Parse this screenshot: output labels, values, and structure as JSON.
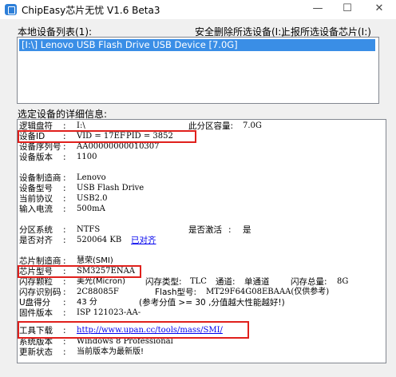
{
  "window": {
    "title": "ChipEasy芯片无忧 V1.6 Beta3",
    "min_glyph": "—",
    "max_glyph": "☐",
    "close_glyph": "✕"
  },
  "toolbar": {
    "device_list_label": "本地设备列表(1):",
    "safe_remove_link": "安全删除所选设备(I:)",
    "report_chip_link": "上报所选设备芯片(I:)"
  },
  "device_list": {
    "items": [
      "[I:\\] Lenovo USB Flash Drive USB Device [7.0G]"
    ]
  },
  "details": {
    "section_label": "选定设备的详细信息:",
    "logical_drive": {
      "label": "逻辑盘符",
      "value": "I:\\"
    },
    "partition_capacity": {
      "label": "此分区容量:",
      "value": "7.0G"
    },
    "device_id": {
      "label": "设备ID",
      "vid": "VID = 17EF",
      "pid": "PID = 3852"
    },
    "serial": {
      "label": "设备序列号",
      "value": "AA00000000010307"
    },
    "version": {
      "label": "设备版本",
      "value": "1100"
    },
    "vendor": {
      "label": "设备制造商",
      "value": "Lenovo"
    },
    "model": {
      "label": "设备型号",
      "value": "USB Flash Drive"
    },
    "protocol": {
      "label": "当前协议",
      "value": "USB2.0"
    },
    "current": {
      "label": "输入电流",
      "value": "500mA"
    },
    "filesystem": {
      "label": "分区系统",
      "value": "NTFS"
    },
    "active": {
      "label": "是否激活",
      "value": "是"
    },
    "aligned": {
      "label": "是否对齐",
      "value": "520064 KB",
      "link": "已对齐"
    },
    "chip_vendor": {
      "label": "芯片制造商",
      "value": "慧荣(SMI)"
    },
    "chip_model": {
      "label": "芯片型号",
      "value": "SM3257ENAA"
    },
    "flash_particle": {
      "label": "闪存颗粒",
      "value": "美光(Micron)",
      "type_label": "闪存类型:",
      "type_value": "TLC",
      "channel_label": "通道:",
      "channel_value": "单通道",
      "total_label": "闪存总量:",
      "total_value": "8G"
    },
    "flash_id": {
      "label": "闪存识别码",
      "value": "2C88085F",
      "flash_model_label": "Flash型号:",
      "flash_model_value": "MT29F64G08EBAAA(仅供参考)"
    },
    "udisk_score": {
      "label": "U盘得分",
      "value": "43 分",
      "note": "(参考分值 >= 30 ,分值越大性能越好!)"
    },
    "firmware": {
      "label": "固件版本",
      "value": "ISP 121023-AA-"
    },
    "tool_download": {
      "label": "工具下载",
      "value": "http://www.upan.cc/tools/mass/SMI/"
    },
    "os": {
      "label": "系统版本",
      "value": "Windows 8 Professional"
    },
    "update": {
      "label": "更新状态",
      "value": "当前版本为最新版!"
    }
  },
  "colors": {
    "highlight": "#e0201c",
    "selection": "#3a8ee6",
    "link": "#0000ee"
  }
}
